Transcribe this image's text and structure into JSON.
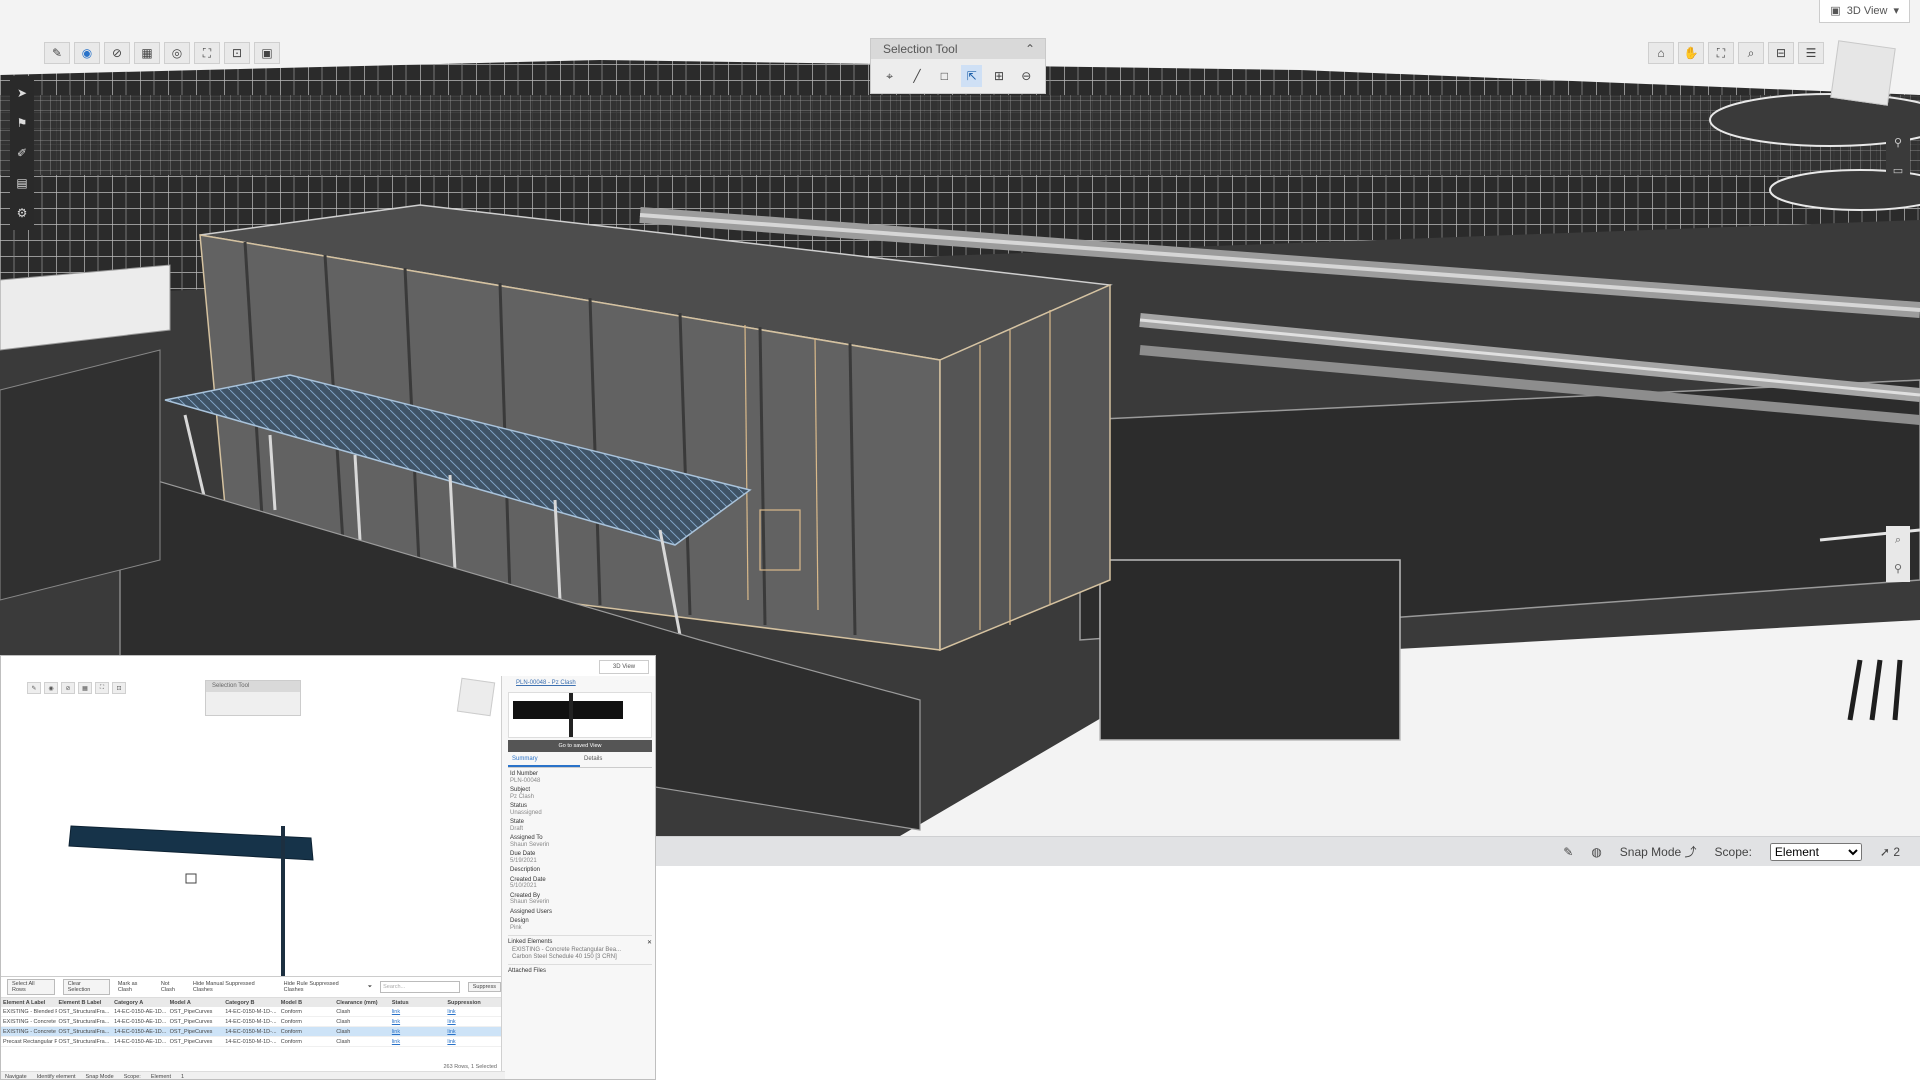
{
  "viewer": {
    "view_mode": "3D View",
    "selection_tool": {
      "title": "Selection Tool"
    },
    "status_bar": {
      "snap_mode": "Snap Mode",
      "scope_label": "Scope:",
      "scope_value": "Element",
      "scope_options": [
        "Element"
      ],
      "selected_count": "2"
    }
  },
  "inset": {
    "view_mode": "3D View",
    "selection_tool_title": "Selection Tool",
    "properties": {
      "title": "PLN-00048 - Pz Clash",
      "goto_label": "Go to saved View",
      "tabs": [
        "Summary",
        "Details"
      ],
      "fields": [
        {
          "k": "Id Number",
          "v": "PLN-00048"
        },
        {
          "k": "Subject",
          "v": "Pz Clash"
        },
        {
          "k": "Status",
          "v": "Unassigned"
        },
        {
          "k": "State",
          "v": "Draft"
        },
        {
          "k": "Assigned To",
          "v": "Shaun Severin"
        },
        {
          "k": "Due Date",
          "v": "5/19/2021"
        },
        {
          "k": "Description",
          "v": ""
        },
        {
          "k": "Created Date",
          "v": "5/10/2021"
        },
        {
          "k": "Created By",
          "v": "Shaun Severin"
        },
        {
          "k": "Assigned Users",
          "v": ""
        },
        {
          "k": "Design",
          "v": "Pink"
        }
      ],
      "linked_elements_title": "Linked Elements",
      "linked_elements": [
        "EXISTING - Concrete Rectangular Bea...",
        "Carbon Steel Schedule 40 150 [3 CRN]"
      ],
      "attached_files_title": "Attached Files"
    },
    "clash": {
      "controls": {
        "select_all": "Select All Rows",
        "clear_selection": "Clear Selection",
        "mark_as": "Mark as Clash",
        "mark_as_not": "Not Clash",
        "hide_manual": "Hide Manual Suppressed Clashes",
        "hide_rule": "Hide Rule Suppressed Clashes",
        "search_placeholder": "Search...",
        "suppress": "Suppress"
      },
      "headers": [
        "Element A Label",
        "Element B Label",
        "Category A",
        "Model A",
        "Category B",
        "Model B",
        "Clearance (mm)",
        "Status",
        "Suppression"
      ],
      "rows": [
        [
          "EXISTING - Blended Pipe Types: EXISTI...",
          "OST_StructuralFra...",
          "14-EC-0150-AE-1D...",
          "OST_PipeCurves",
          "14-EC-0150-M-1D-...",
          "Conform",
          "Clash",
          "link",
          "link"
        ],
        [
          "EXISTING - Concrete Carbon Steel Scher...",
          "OST_StructuralFra...",
          "14-EC-0150-AE-1D...",
          "OST_PipeCurves",
          "14-EC-0150-M-1D-...",
          "Conform",
          "Clash",
          "link",
          "link"
        ],
        [
          "EXISTING - Concrete Carbon Steel Scher...",
          "OST_StructuralFra...",
          "14-EC-0150-AE-1D...",
          "OST_PipeCurves",
          "14-EC-0150-M-1D-...",
          "Conform",
          "Clash",
          "link",
          "link"
        ],
        [
          "Precast Rectangular Pipe Types: PVC - ...",
          "OST_StructuralFra...",
          "14-EC-0150-AE-1D...",
          "OST_PipeCurves",
          "14-EC-0150-M-1D-...",
          "Conform",
          "Clash",
          "link",
          "link"
        ]
      ],
      "row_count": "263 Rows, 1 Selected",
      "footer": {
        "navigate": "Navigate",
        "identify": "Identify element",
        "snap_mode": "Snap Mode",
        "scope": "Scope:",
        "scope_value": "Element",
        "selected_count": "1"
      }
    }
  }
}
